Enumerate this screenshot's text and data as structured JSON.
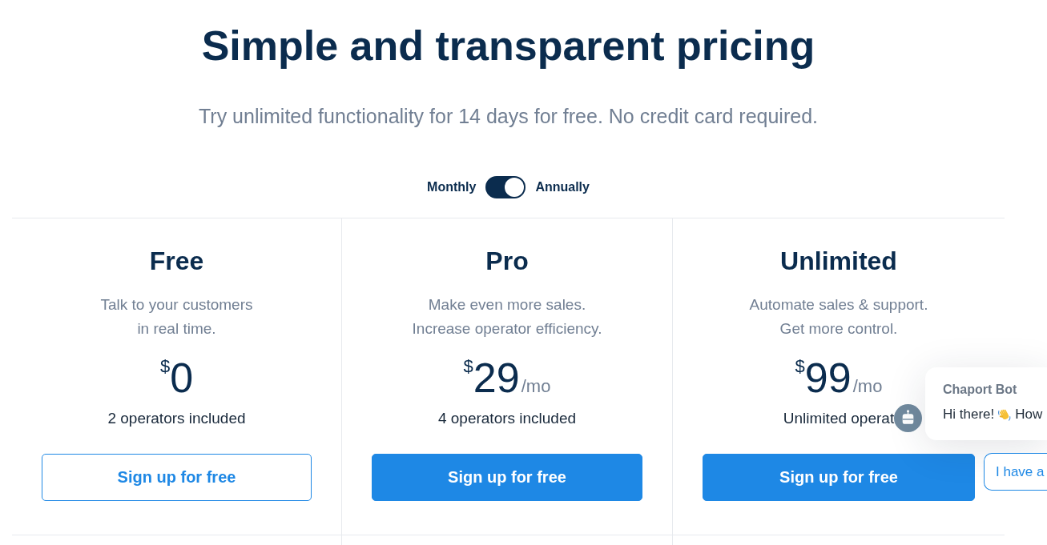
{
  "header": {
    "title": "Simple and transparent pricing",
    "subtitle": "Try unlimited functionality for 14 days for free. No credit card required."
  },
  "billing_toggle": {
    "left_label": "Monthly",
    "right_label": "Annually",
    "on": true
  },
  "plans": [
    {
      "name": "Free",
      "description": "Talk to your customers\nin real time.",
      "currency": "$",
      "amount": "0",
      "operators": "2 operators included",
      "button": {
        "label": "Sign up for free",
        "kind": "outline"
      }
    },
    {
      "name": "Pro",
      "description": "Make even more sales.\nIncrease operator efficiency.",
      "currency": "$",
      "amount": "29",
      "period": "/mo",
      "operators": "4 operators included",
      "button": {
        "label": "Sign up for free",
        "kind": "filled"
      }
    },
    {
      "name": "Unlimited",
      "description": "Automate sales & support.\nGet more control.",
      "currency": "$",
      "amount": "99",
      "period": "/mo",
      "operators": "Unlimited operat",
      "button": {
        "label": "Sign up for free",
        "kind": "filled"
      }
    }
  ],
  "chat_widget": {
    "sender": "Chaport Bot",
    "message_parts": [
      "Hi there!",
      "How"
    ],
    "quick_reply": "I have a"
  }
}
